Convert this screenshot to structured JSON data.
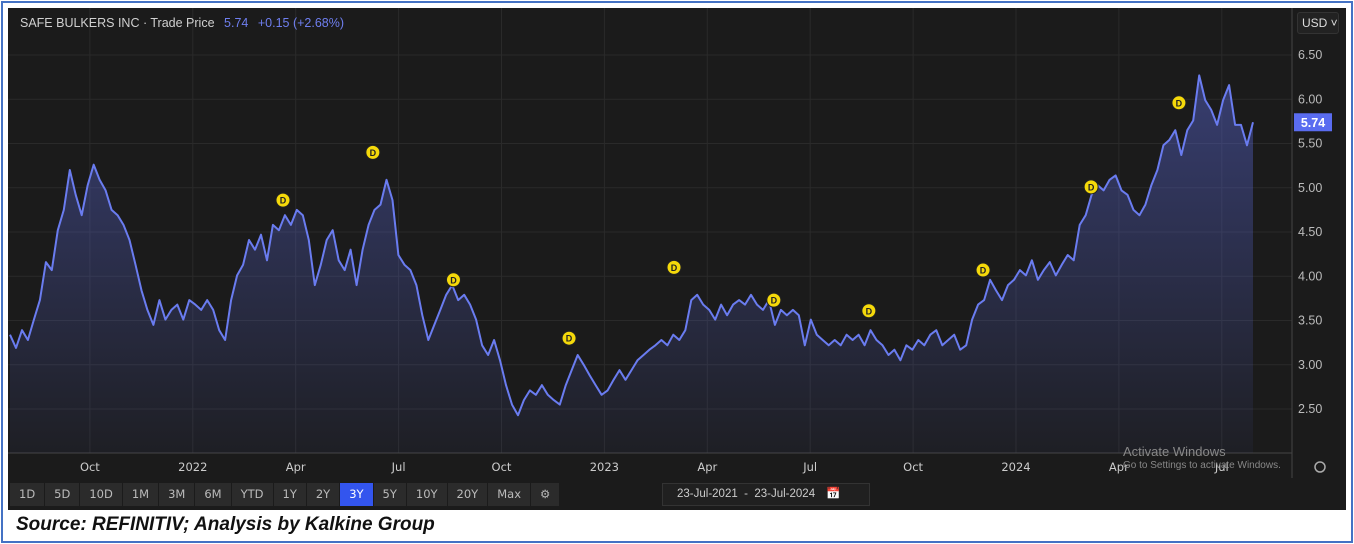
{
  "header": {
    "name": "SAFE BULKERS INC",
    "separator": "·",
    "series": "Trade Price",
    "price": "5.74",
    "change": "+0.15 (+2.68%)"
  },
  "currency": "USD ˅",
  "last_price_label": "5.74",
  "buttons": [
    "1D",
    "5D",
    "10D",
    "1M",
    "3M",
    "6M",
    "YTD",
    "1Y",
    "2Y",
    "3Y",
    "5Y",
    "10Y",
    "20Y",
    "Max"
  ],
  "active_button": "3Y",
  "date_range": {
    "from": "23-Jul-2021",
    "sep": "-",
    "to": "23-Jul-2024"
  },
  "watermark": {
    "title": "Activate Windows",
    "sub": "Go to Settings to activate Windows."
  },
  "source": "Source: REFINITIV; Analysis by Kalkine Group",
  "colors": {
    "line": "#6a7cf0",
    "bg": "#1b1b1b",
    "dividend": "#f5d90a",
    "accent": "#3355ee"
  },
  "chart_data": {
    "type": "area",
    "title": "SAFE BULKERS INC · Trade Price",
    "x_range_months": [
      0,
      36
    ],
    "x_ticks": [
      {
        "label": "Oct",
        "m": 2.3
      },
      {
        "label": "2022",
        "m": 5.3
      },
      {
        "label": "Apr",
        "m": 8.3
      },
      {
        "label": "Jul",
        "m": 11.3
      },
      {
        "label": "Oct",
        "m": 14.3
      },
      {
        "label": "2023",
        "m": 17.3
      },
      {
        "label": "Apr",
        "m": 20.3
      },
      {
        "label": "Jul",
        "m": 23.3
      },
      {
        "label": "Oct",
        "m": 26.3
      },
      {
        "label": "2024",
        "m": 29.3
      },
      {
        "label": "Apr",
        "m": 32.3
      },
      {
        "label": "Jul",
        "m": 35.3
      }
    ],
    "y_ticks": [
      "2.50",
      "3.00",
      "3.50",
      "4.00",
      "4.50",
      "5.00",
      "5.50",
      "6.00",
      "6.50"
    ],
    "ylim": [
      1.93,
      6.87
    ],
    "prices": [
      3.34,
      3.19,
      3.39,
      3.28,
      3.51,
      3.73,
      4.16,
      4.07,
      4.52,
      4.75,
      5.2,
      4.92,
      4.69,
      5.03,
      5.26,
      5.09,
      4.97,
      4.75,
      4.69,
      4.58,
      4.41,
      4.13,
      3.84,
      3.62,
      3.45,
      3.73,
      3.51,
      3.62,
      3.68,
      3.51,
      3.73,
      3.68,
      3.62,
      3.73,
      3.62,
      3.39,
      3.28,
      3.73,
      4.01,
      4.13,
      4.41,
      4.3,
      4.47,
      4.18,
      4.58,
      4.52,
      4.69,
      4.58,
      4.75,
      4.69,
      4.41,
      3.9,
      4.13,
      4.41,
      4.52,
      4.18,
      4.07,
      4.3,
      3.9,
      4.3,
      4.58,
      4.75,
      4.81,
      5.09,
      4.86,
      4.24,
      4.13,
      4.07,
      3.9,
      3.56,
      3.28,
      3.45,
      3.62,
      3.79,
      3.9,
      3.73,
      3.79,
      3.68,
      3.51,
      3.22,
      3.11,
      3.28,
      3.05,
      2.77,
      2.55,
      2.43,
      2.6,
      2.71,
      2.66,
      2.77,
      2.66,
      2.6,
      2.55,
      2.77,
      2.94,
      3.11,
      3.0,
      2.88,
      2.77,
      2.66,
      2.71,
      2.83,
      2.94,
      2.83,
      2.94,
      3.05,
      3.11,
      3.17,
      3.22,
      3.28,
      3.22,
      3.34,
      3.28,
      3.39,
      3.73,
      3.79,
      3.68,
      3.62,
      3.51,
      3.68,
      3.56,
      3.68,
      3.73,
      3.68,
      3.79,
      3.68,
      3.62,
      3.73,
      3.45,
      3.62,
      3.56,
      3.62,
      3.56,
      3.22,
      3.51,
      3.34,
      3.28,
      3.22,
      3.28,
      3.22,
      3.34,
      3.28,
      3.34,
      3.22,
      3.39,
      3.28,
      3.22,
      3.11,
      3.17,
      3.05,
      3.22,
      3.17,
      3.28,
      3.22,
      3.34,
      3.39,
      3.22,
      3.28,
      3.34,
      3.17,
      3.22,
      3.51,
      3.68,
      3.73,
      3.96,
      3.84,
      3.73,
      3.9,
      3.96,
      4.07,
      4.01,
      4.18,
      3.96,
      4.07,
      4.16,
      4.01,
      4.13,
      4.24,
      4.18,
      4.58,
      4.69,
      4.92,
      5.03,
      4.97,
      5.09,
      5.14,
      4.97,
      4.92,
      4.75,
      4.69,
      4.81,
      5.03,
      5.2,
      5.48,
      5.54,
      5.65,
      5.37,
      5.65,
      5.76,
      6.27,
      5.99,
      5.88,
      5.71,
      5.99,
      6.16,
      5.71,
      5.71,
      5.48,
      5.74
    ],
    "dividends": [
      {
        "m": 7.93,
        "y": 4.86
      },
      {
        "m": 10.55,
        "y": 5.4
      },
      {
        "m": 12.9,
        "y": 3.96
      },
      {
        "m": 16.27,
        "y": 3.3
      },
      {
        "m": 19.33,
        "y": 4.1
      },
      {
        "m": 22.24,
        "y": 3.73
      },
      {
        "m": 25.01,
        "y": 3.61
      },
      {
        "m": 28.34,
        "y": 4.07
      },
      {
        "m": 31.49,
        "y": 5.01
      },
      {
        "m": 34.05,
        "y": 5.96
      }
    ],
    "dividend_label": "D"
  }
}
